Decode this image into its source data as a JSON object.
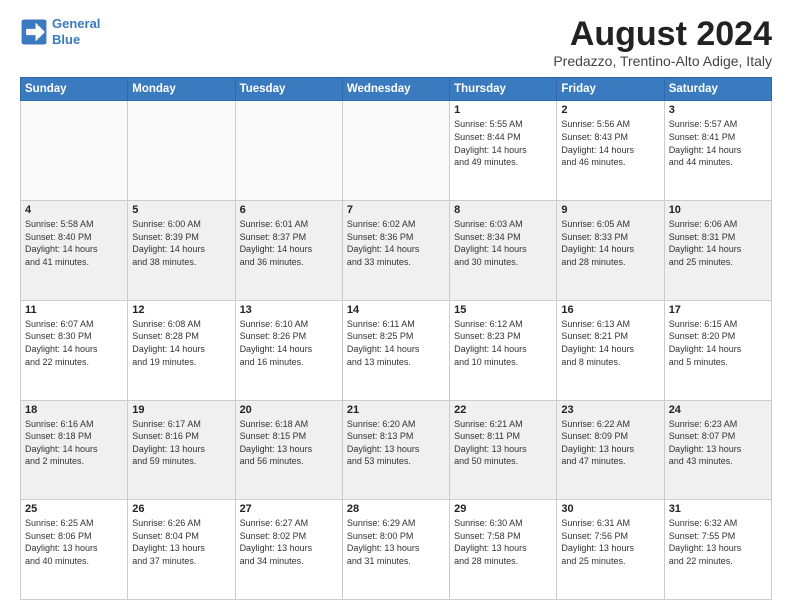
{
  "logo": {
    "line1": "General",
    "line2": "Blue"
  },
  "title": "August 2024",
  "subtitle": "Predazzo, Trentino-Alto Adige, Italy",
  "headers": [
    "Sunday",
    "Monday",
    "Tuesday",
    "Wednesday",
    "Thursday",
    "Friday",
    "Saturday"
  ],
  "weeks": [
    [
      {
        "day": "",
        "info": ""
      },
      {
        "day": "",
        "info": ""
      },
      {
        "day": "",
        "info": ""
      },
      {
        "day": "",
        "info": ""
      },
      {
        "day": "1",
        "info": "Sunrise: 5:55 AM\nSunset: 8:44 PM\nDaylight: 14 hours\nand 49 minutes."
      },
      {
        "day": "2",
        "info": "Sunrise: 5:56 AM\nSunset: 8:43 PM\nDaylight: 14 hours\nand 46 minutes."
      },
      {
        "day": "3",
        "info": "Sunrise: 5:57 AM\nSunset: 8:41 PM\nDaylight: 14 hours\nand 44 minutes."
      }
    ],
    [
      {
        "day": "4",
        "info": "Sunrise: 5:58 AM\nSunset: 8:40 PM\nDaylight: 14 hours\nand 41 minutes."
      },
      {
        "day": "5",
        "info": "Sunrise: 6:00 AM\nSunset: 8:39 PM\nDaylight: 14 hours\nand 38 minutes."
      },
      {
        "day": "6",
        "info": "Sunrise: 6:01 AM\nSunset: 8:37 PM\nDaylight: 14 hours\nand 36 minutes."
      },
      {
        "day": "7",
        "info": "Sunrise: 6:02 AM\nSunset: 8:36 PM\nDaylight: 14 hours\nand 33 minutes."
      },
      {
        "day": "8",
        "info": "Sunrise: 6:03 AM\nSunset: 8:34 PM\nDaylight: 14 hours\nand 30 minutes."
      },
      {
        "day": "9",
        "info": "Sunrise: 6:05 AM\nSunset: 8:33 PM\nDaylight: 14 hours\nand 28 minutes."
      },
      {
        "day": "10",
        "info": "Sunrise: 6:06 AM\nSunset: 8:31 PM\nDaylight: 14 hours\nand 25 minutes."
      }
    ],
    [
      {
        "day": "11",
        "info": "Sunrise: 6:07 AM\nSunset: 8:30 PM\nDaylight: 14 hours\nand 22 minutes."
      },
      {
        "day": "12",
        "info": "Sunrise: 6:08 AM\nSunset: 8:28 PM\nDaylight: 14 hours\nand 19 minutes."
      },
      {
        "day": "13",
        "info": "Sunrise: 6:10 AM\nSunset: 8:26 PM\nDaylight: 14 hours\nand 16 minutes."
      },
      {
        "day": "14",
        "info": "Sunrise: 6:11 AM\nSunset: 8:25 PM\nDaylight: 14 hours\nand 13 minutes."
      },
      {
        "day": "15",
        "info": "Sunrise: 6:12 AM\nSunset: 8:23 PM\nDaylight: 14 hours\nand 10 minutes."
      },
      {
        "day": "16",
        "info": "Sunrise: 6:13 AM\nSunset: 8:21 PM\nDaylight: 14 hours\nand 8 minutes."
      },
      {
        "day": "17",
        "info": "Sunrise: 6:15 AM\nSunset: 8:20 PM\nDaylight: 14 hours\nand 5 minutes."
      }
    ],
    [
      {
        "day": "18",
        "info": "Sunrise: 6:16 AM\nSunset: 8:18 PM\nDaylight: 14 hours\nand 2 minutes."
      },
      {
        "day": "19",
        "info": "Sunrise: 6:17 AM\nSunset: 8:16 PM\nDaylight: 13 hours\nand 59 minutes."
      },
      {
        "day": "20",
        "info": "Sunrise: 6:18 AM\nSunset: 8:15 PM\nDaylight: 13 hours\nand 56 minutes."
      },
      {
        "day": "21",
        "info": "Sunrise: 6:20 AM\nSunset: 8:13 PM\nDaylight: 13 hours\nand 53 minutes."
      },
      {
        "day": "22",
        "info": "Sunrise: 6:21 AM\nSunset: 8:11 PM\nDaylight: 13 hours\nand 50 minutes."
      },
      {
        "day": "23",
        "info": "Sunrise: 6:22 AM\nSunset: 8:09 PM\nDaylight: 13 hours\nand 47 minutes."
      },
      {
        "day": "24",
        "info": "Sunrise: 6:23 AM\nSunset: 8:07 PM\nDaylight: 13 hours\nand 43 minutes."
      }
    ],
    [
      {
        "day": "25",
        "info": "Sunrise: 6:25 AM\nSunset: 8:06 PM\nDaylight: 13 hours\nand 40 minutes."
      },
      {
        "day": "26",
        "info": "Sunrise: 6:26 AM\nSunset: 8:04 PM\nDaylight: 13 hours\nand 37 minutes."
      },
      {
        "day": "27",
        "info": "Sunrise: 6:27 AM\nSunset: 8:02 PM\nDaylight: 13 hours\nand 34 minutes."
      },
      {
        "day": "28",
        "info": "Sunrise: 6:29 AM\nSunset: 8:00 PM\nDaylight: 13 hours\nand 31 minutes."
      },
      {
        "day": "29",
        "info": "Sunrise: 6:30 AM\nSunset: 7:58 PM\nDaylight: 13 hours\nand 28 minutes."
      },
      {
        "day": "30",
        "info": "Sunrise: 6:31 AM\nSunset: 7:56 PM\nDaylight: 13 hours\nand 25 minutes."
      },
      {
        "day": "31",
        "info": "Sunrise: 6:32 AM\nSunset: 7:55 PM\nDaylight: 13 hours\nand 22 minutes."
      }
    ]
  ]
}
